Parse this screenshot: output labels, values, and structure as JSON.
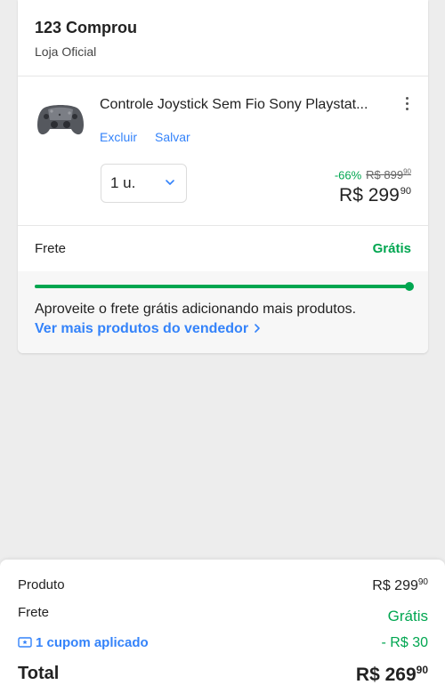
{
  "seller": {
    "name": "123 Comprou",
    "type": "Loja Oficial"
  },
  "item": {
    "title": "Controle Joystick Sem Fio Sony Playstat...",
    "actions": {
      "delete": "Excluir",
      "save": "Salvar"
    },
    "quantity": "1 u.",
    "discount": "-66%",
    "old_price": "R$ 899",
    "old_price_cents": "90",
    "price": "R$ 299",
    "price_cents": "90"
  },
  "shipping": {
    "label": "Frete",
    "value": "Grátis",
    "progress": 1.0,
    "message": "Aproveite o frete grátis adicionando mais produtos.",
    "link": "Ver mais produtos do vendedor"
  },
  "summary": {
    "product_label": "Produto",
    "product_value": "R$ 299",
    "product_cents": "90",
    "shipping_label": "Frete",
    "shipping_value": "Grátis",
    "coupon_label": "1 cupom aplicado",
    "coupon_value": "- R$ 30",
    "total_label": "Total",
    "total_value": "R$ 269",
    "total_cents": "90"
  },
  "colors": {
    "green": "#00a650",
    "blue": "#3483fa",
    "background": "#ededed"
  },
  "icons": [
    "kebab-menu-icon",
    "chevron-down-icon",
    "chevron-right-icon",
    "coupon-ticket-icon"
  ]
}
